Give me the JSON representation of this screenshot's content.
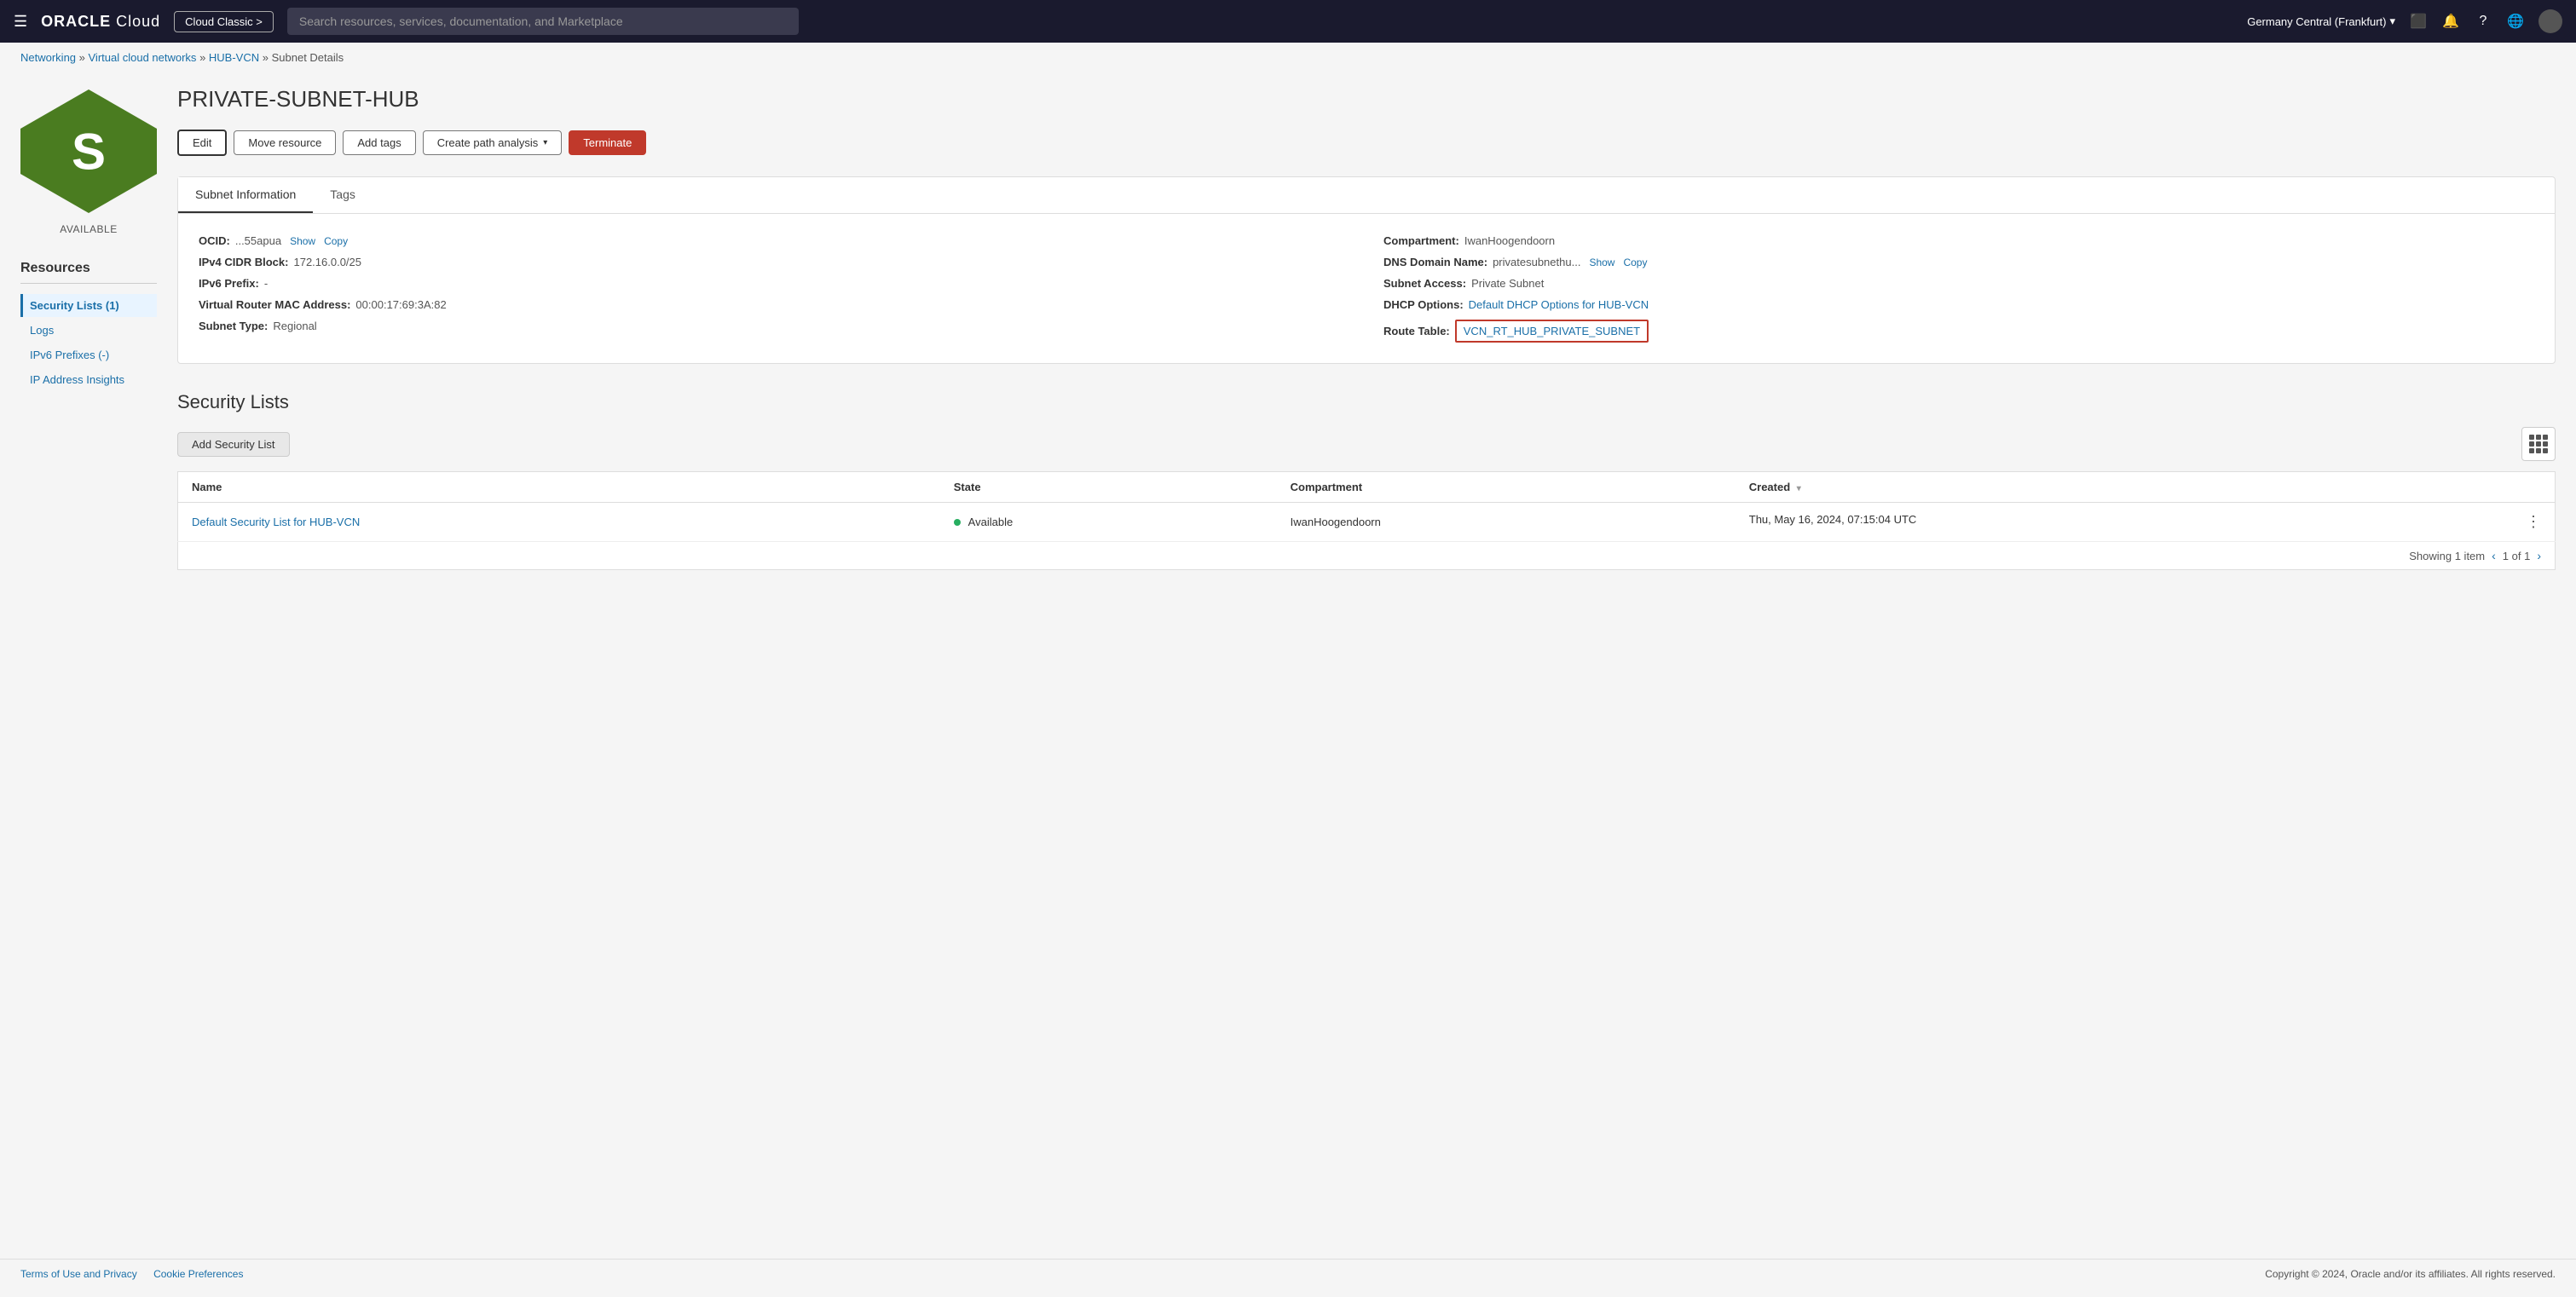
{
  "topnav": {
    "logo": "ORACLE Cloud",
    "cloud_classic": "Cloud Classic >",
    "search_placeholder": "Search resources, services, documentation, and Marketplace",
    "region": "Germany Central (Frankfurt)",
    "region_chevron": "▾"
  },
  "breadcrumb": {
    "networking": "Networking",
    "vcn_list": "Virtual cloud networks",
    "vcn_name": "HUB-VCN",
    "current": "Subnet Details"
  },
  "page": {
    "title": "PRIVATE-SUBNET-HUB",
    "status": "AVAILABLE",
    "hex_letter": "S"
  },
  "buttons": {
    "edit": "Edit",
    "move_resource": "Move resource",
    "add_tags": "Add tags",
    "create_path_analysis": "Create path analysis",
    "terminate": "Terminate"
  },
  "tabs": {
    "subnet_information": "Subnet Information",
    "tags": "Tags"
  },
  "subnet_info": {
    "ocid_label": "OCID:",
    "ocid_value": "...55apua",
    "ocid_show": "Show",
    "ocid_copy": "Copy",
    "ipv4_label": "IPv4 CIDR Block:",
    "ipv4_value": "172.16.0.0/25",
    "ipv6_label": "IPv6 Prefix:",
    "ipv6_value": "-",
    "mac_label": "Virtual Router MAC Address:",
    "mac_value": "00:00:17:69:3A:82",
    "subnet_type_label": "Subnet Type:",
    "subnet_type_value": "Regional",
    "compartment_label": "Compartment:",
    "compartment_value": "IwanHoogendoorn",
    "dns_label": "DNS Domain Name:",
    "dns_value": "privatesubnethu...",
    "dns_show": "Show",
    "dns_copy": "Copy",
    "subnet_access_label": "Subnet Access:",
    "subnet_access_value": "Private Subnet",
    "dhcp_label": "DHCP Options:",
    "dhcp_value": "Default DHCP Options for HUB-VCN",
    "route_table_label": "Route Table:",
    "route_table_value": "VCN_RT_HUB_PRIVATE_SUBNET"
  },
  "resources": {
    "title": "Resources",
    "items": [
      {
        "label": "Security Lists (1)",
        "active": true
      },
      {
        "label": "Logs",
        "active": false
      },
      {
        "label": "IPv6 Prefixes (-)",
        "active": false
      },
      {
        "label": "IP Address Insights",
        "active": false
      }
    ]
  },
  "security_lists": {
    "title": "Security Lists",
    "add_button": "Add Security List",
    "columns": [
      {
        "label": "Name",
        "sortable": false
      },
      {
        "label": "State",
        "sortable": false
      },
      {
        "label": "Compartment",
        "sortable": false
      },
      {
        "label": "Created",
        "sortable": true
      }
    ],
    "rows": [
      {
        "name": "Default Security List for HUB-VCN",
        "state": "Available",
        "compartment": "IwanHoogendoorn",
        "created": "Thu, May 16, 2024, 07:15:04 UTC"
      }
    ],
    "showing": "Showing 1 item",
    "page_info": "1 of 1"
  },
  "footer": {
    "terms": "Terms of Use and Privacy",
    "cookies": "Cookie Preferences",
    "copyright": "Copyright © 2024, Oracle and/or its affiliates. All rights reserved."
  }
}
